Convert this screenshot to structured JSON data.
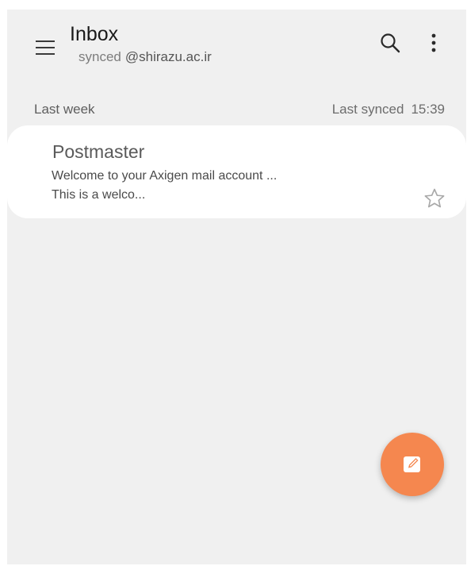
{
  "header": {
    "title": "Inbox",
    "sync_prefix": "synced",
    "account_email": "@shirazu.ac.ir",
    "menu_icon": "hamburger-menu-icon",
    "search_icon": "search-icon",
    "more_icon": "more-vertical-icon"
  },
  "section": {
    "title": "Last week",
    "last_synced_label": "Last synced",
    "last_synced_time": "15:39"
  },
  "messages": [
    {
      "sender": "Postmaster",
      "subject": "Welcome to your Axigen mail account ...",
      "preview": "This is a welco...",
      "starred": false,
      "star_icon": "star-outline-icon"
    }
  ],
  "compose": {
    "icon": "compose-icon"
  },
  "colors": {
    "accent": "#f5874f",
    "background": "#f0f0f0",
    "card": "#ffffff"
  }
}
